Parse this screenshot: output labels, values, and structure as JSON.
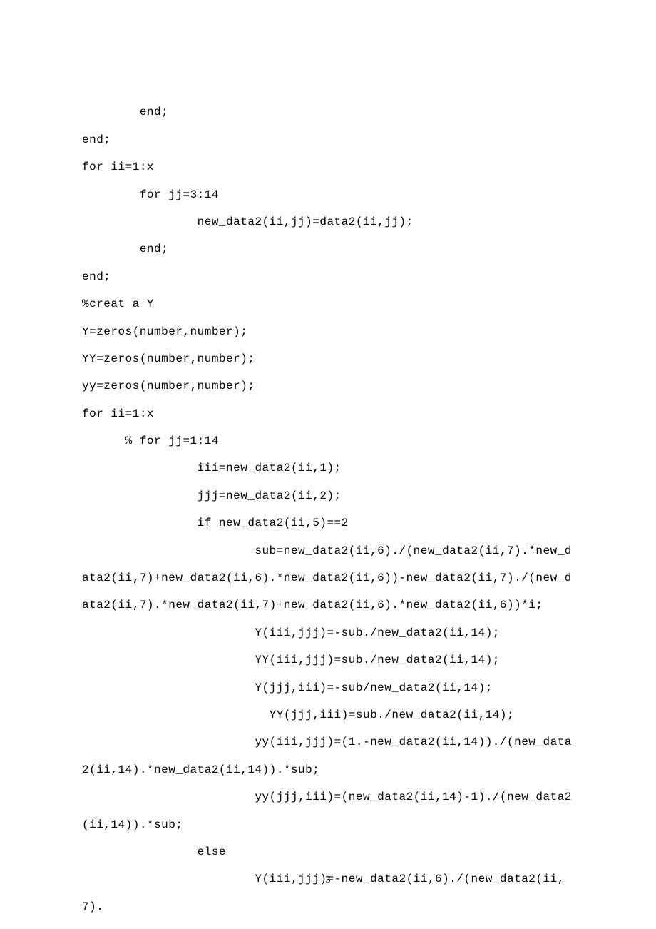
{
  "pageNumber": "3",
  "code": {
    "line1": "        end;",
    "line2": "end;",
    "line3": "for ii=1:x",
    "line4": "        for jj=3:14",
    "line5": "                new_data2(ii,jj)=data2(ii,jj);",
    "line6": "        end;",
    "line7": "end;",
    "line8": "%creat a Y",
    "line9": "Y=zeros(number,number);",
    "line10": "YY=zeros(number,number);",
    "line11": "yy=zeros(number,number);",
    "line12": "for ii=1:x",
    "line13": "      % for jj=1:14",
    "line14": "                iii=new_data2(ii,1);",
    "line15": "                jjj=new_data2(ii,2);",
    "line16": "                if new_data2(ii,5)==2",
    "line17": "                        sub=new_data2(ii,6)./(new_data2(ii,7).*new_data2(ii,7)+new_data2(ii,6).*new_data2(ii,6))-new_data2(ii,7)./(new_data2(ii,7).*new_data2(ii,7)+new_data2(ii,6).*new_data2(ii,6))*i;",
    "line18": "                        Y(iii,jjj)=-sub./new_data2(ii,14);",
    "line19": "                        YY(iii,jjj)=sub./new_data2(ii,14);",
    "line20": "                        Y(jjj,iii)=-sub/new_data2(ii,14);",
    "line21": "                          YY(jjj,iii)=sub./new_data2(ii,14);",
    "line22": "                        yy(iii,jjj)=(1.-new_data2(ii,14))./(new_data2(ii,14).*new_data2(ii,14)).*sub;",
    "line23": "                        yy(jjj,iii)=(new_data2(ii,14)-1)./(new_data2(ii,14)).*sub;",
    "line24": "                else",
    "line25": "                        Y(iii,jjj)=-new_data2(ii,6)./(new_data2(ii,7)."
  }
}
